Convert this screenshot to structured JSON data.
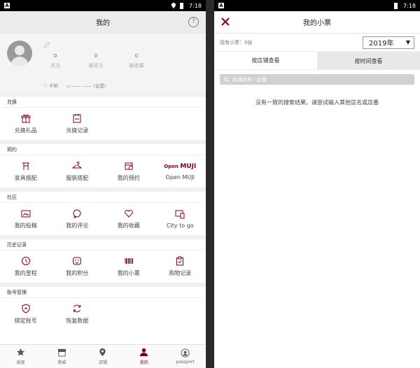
{
  "status": {
    "time": "7:18"
  },
  "left": {
    "title": "我的",
    "help_glyph": "?",
    "profile": {
      "stats": [
        {
          "count": "0",
          "label": "关注"
        },
        {
          "count": "0",
          "label": "被关注"
        },
        {
          "count": "0",
          "label": "被收藏"
        }
      ],
      "gender": "不明",
      "date": "—— ——",
      "date_suffix": "(设置)"
    },
    "sections": [
      {
        "title": "兑换",
        "items": [
          {
            "label": "兑换礼品",
            "icon": "gift-icon"
          },
          {
            "label": "兑换记录",
            "icon": "record-icon"
          }
        ]
      },
      {
        "title": "预约",
        "items": [
          {
            "label": "家具搭配",
            "icon": "furniture-icon"
          },
          {
            "label": "服装搭配",
            "icon": "hanger-icon"
          },
          {
            "label": "我的预约",
            "icon": "calendar-icon"
          },
          {
            "label": "Open MUJI",
            "icon": "open-muji-logo",
            "logo_prefix": "Open",
            "logo_brand": "MUJI"
          }
        ]
      },
      {
        "title": "社区",
        "items": [
          {
            "label": "我的投稿",
            "icon": "image-icon"
          },
          {
            "label": "我的评论",
            "icon": "comment-icon"
          },
          {
            "label": "我的收藏",
            "icon": "heart-icon"
          },
          {
            "label": "City to go",
            "icon": "monitor-icon"
          }
        ]
      },
      {
        "title": "历史记录",
        "items": [
          {
            "label": "我的里程",
            "icon": "clock-icon"
          },
          {
            "label": "我的积分",
            "icon": "points-icon"
          },
          {
            "label": "我的小票",
            "icon": "barcode-icon"
          },
          {
            "label": "购物记录",
            "icon": "clipboard-icon"
          }
        ]
      },
      {
        "title": "账号管理",
        "items": [
          {
            "label": "绑定账号",
            "icon": "shield-link-icon"
          },
          {
            "label": "恢复数据",
            "icon": "refresh-icon"
          }
        ]
      }
    ],
    "tabbar": [
      {
        "label": "发现",
        "icon": "star-icon",
        "active": false
      },
      {
        "label": "商城",
        "icon": "shop-icon",
        "active": false
      },
      {
        "label": "店铺",
        "icon": "location-icon",
        "active": false
      },
      {
        "label": "我的",
        "icon": "person-icon",
        "active": true
      },
      {
        "label": "passport",
        "icon": "passport-icon",
        "active": false
      }
    ]
  },
  "right": {
    "title": "我的小票",
    "count_label": "现有小票：0张",
    "year": "2019年",
    "tabs": [
      "按店铺查看",
      "按时间查看"
    ],
    "search_placeholder": "店铺名称・店番",
    "empty_message": "没有一致的搜索结果。请尝试输入其他店名或店番"
  },
  "colors": {
    "accent": "#7f0019"
  }
}
